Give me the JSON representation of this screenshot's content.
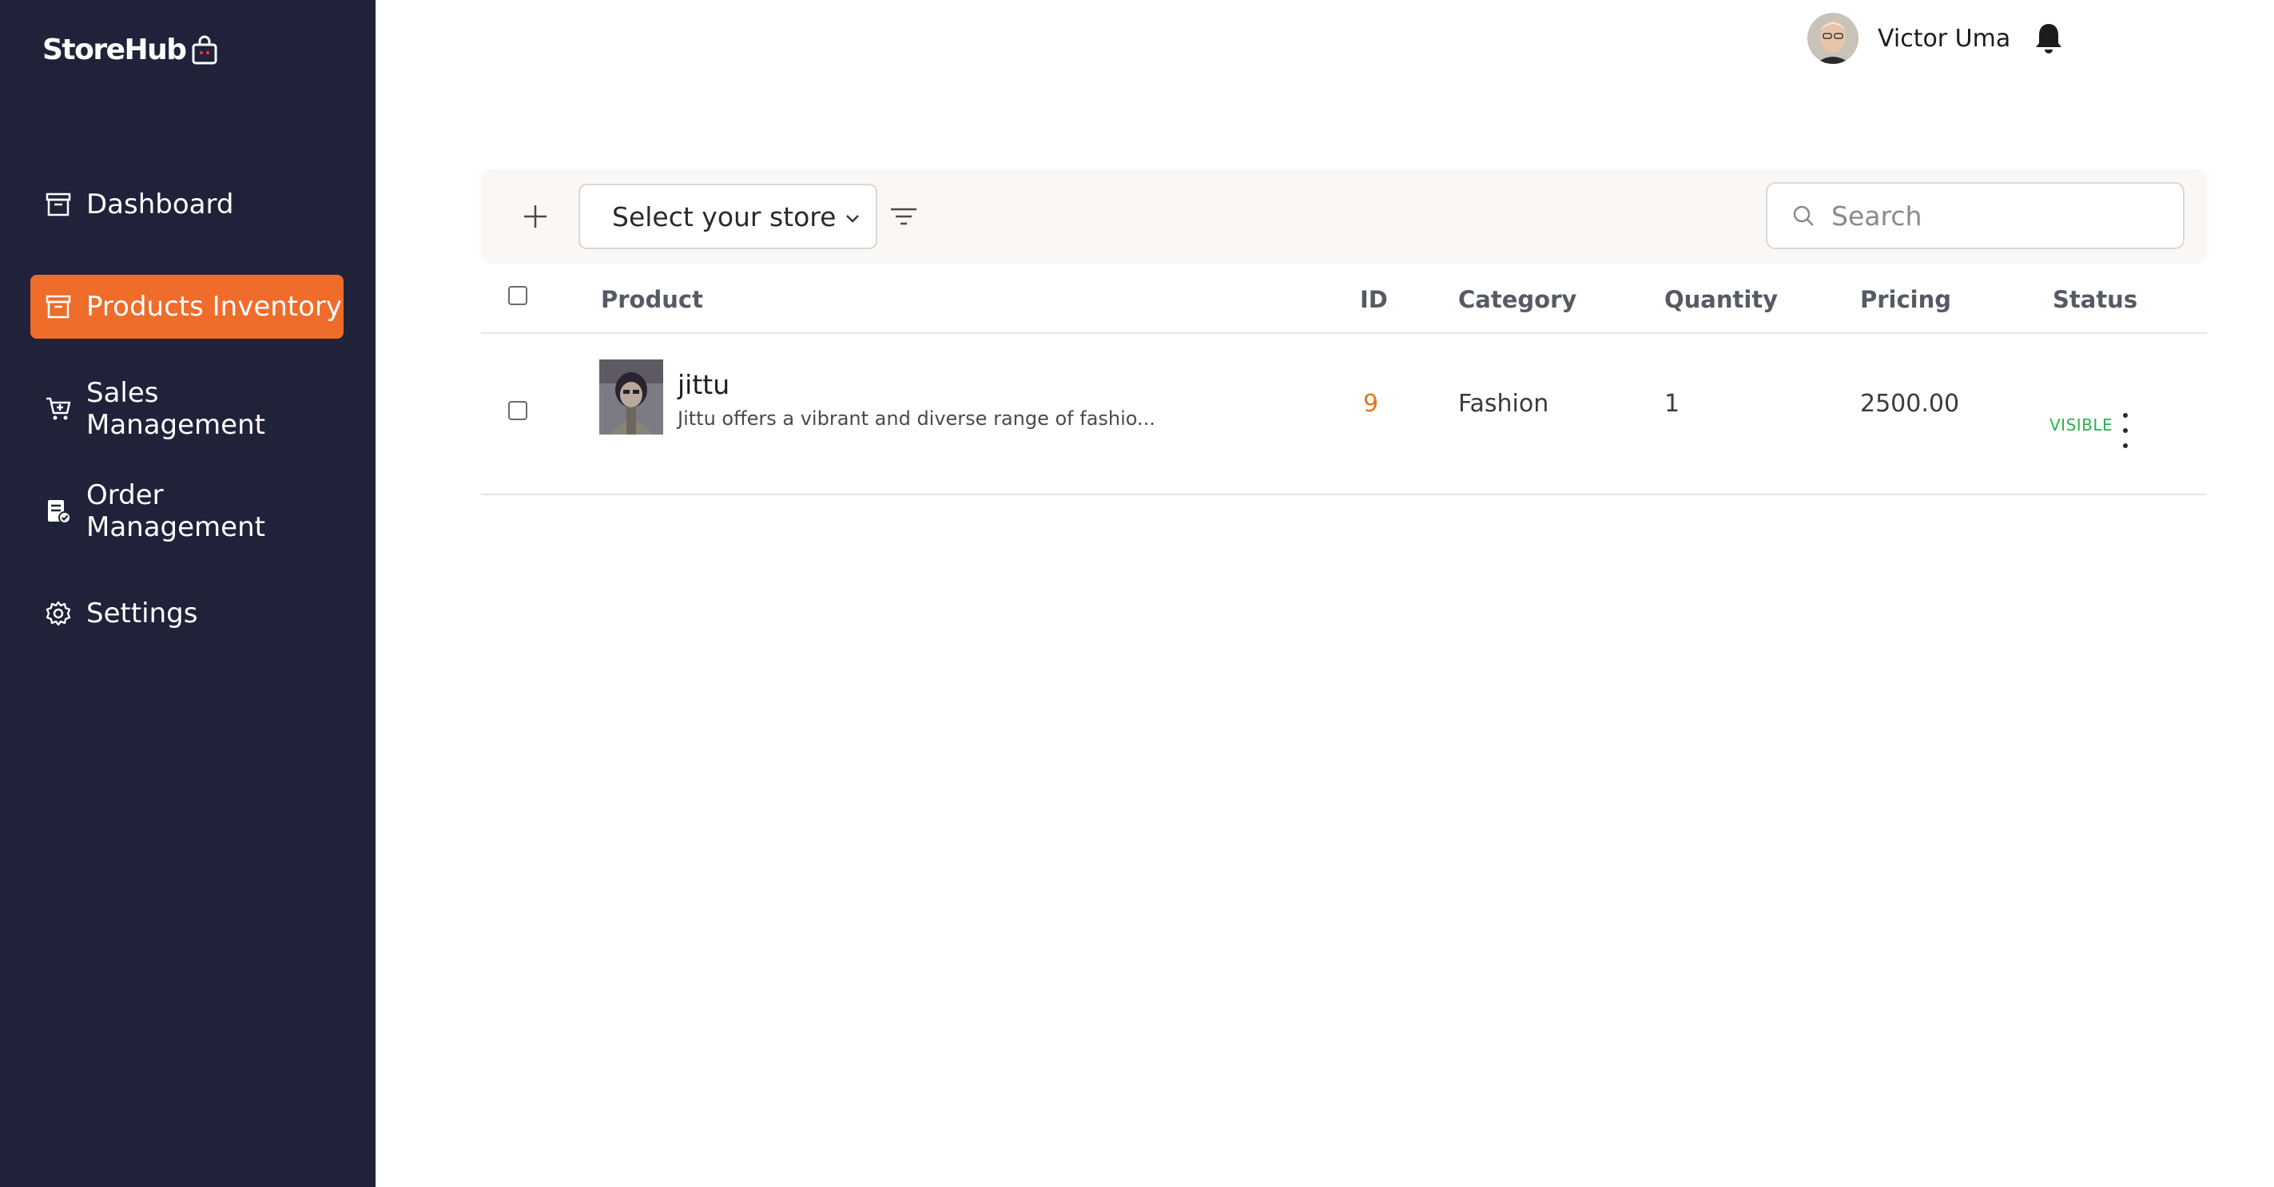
{
  "sidebar": {
    "logo_text": "StoreHub",
    "items": [
      {
        "label": "Dashboard",
        "icon": "archive-box-icon",
        "active": false
      },
      {
        "label": "Products Inventory",
        "icon": "archive-box-icon",
        "active": true
      },
      {
        "label": "Sales Management",
        "icon": "cart-icon",
        "active": false
      },
      {
        "label": "Order Management",
        "icon": "order-check-icon",
        "active": false
      },
      {
        "label": "Settings",
        "icon": "gear-icon",
        "active": false
      }
    ]
  },
  "header": {
    "user_name": "Victor Uma"
  },
  "toolbar": {
    "store_select_value": "Select your store",
    "search_placeholder": "Search"
  },
  "table": {
    "columns": {
      "product": "Product",
      "id": "ID",
      "category": "Category",
      "quantity": "Quantity",
      "pricing": "Pricing",
      "status": "Status"
    },
    "rows": [
      {
        "name": "jittu",
        "description": "Jittu offers a vibrant and diverse range of fashio...",
        "id": "9",
        "category": "Fashion",
        "quantity": "1",
        "pricing": "2500.00",
        "status": "VISIBLE"
      }
    ]
  },
  "colors": {
    "sidebar_bg": "#20223a",
    "accent": "#ef6c2a",
    "status_visible": "#2bb24c",
    "id_text": "#e6761f",
    "toolbar_bg": "#fbf7f4"
  }
}
